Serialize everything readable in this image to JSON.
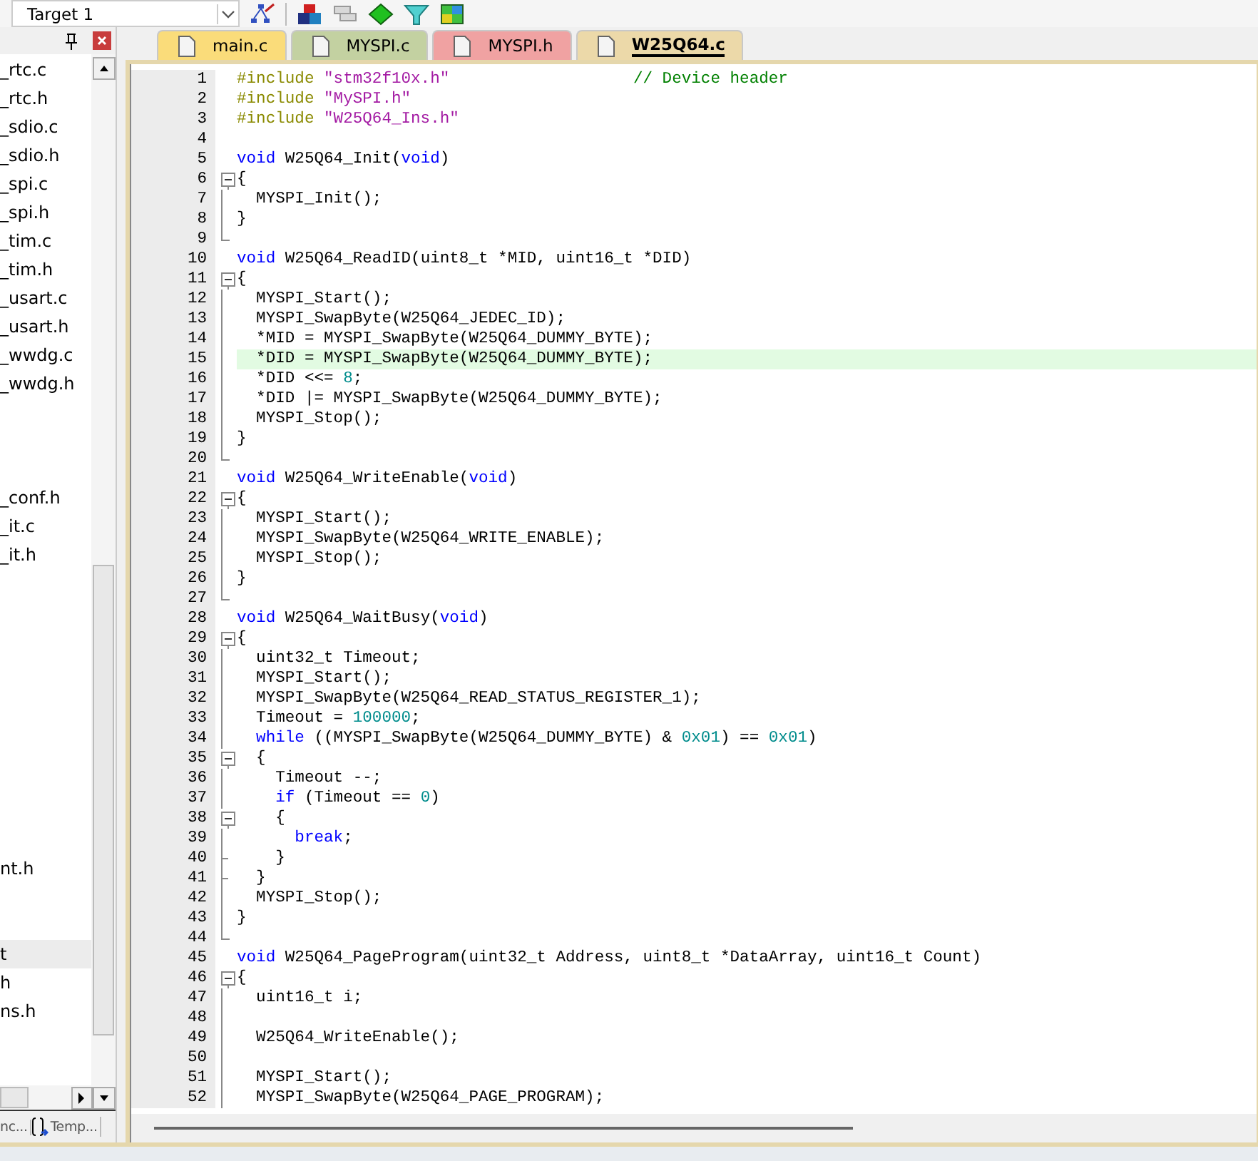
{
  "toolbar": {
    "target": "Target 1"
  },
  "project_panel": {
    "file_groups": [
      [
        {
          "name": "_rtc.c",
          "selected": false
        },
        {
          "name": "_rtc.h",
          "selected": false
        },
        {
          "name": "_sdio.c",
          "selected": false
        },
        {
          "name": "_sdio.h",
          "selected": false
        },
        {
          "name": "_spi.c",
          "selected": false
        },
        {
          "name": "_spi.h",
          "selected": false
        },
        {
          "name": "_tim.c",
          "selected": false
        },
        {
          "name": "_tim.h",
          "selected": false
        },
        {
          "name": "_usart.c",
          "selected": false
        },
        {
          "name": "_usart.h",
          "selected": false
        },
        {
          "name": "_wwdg.c",
          "selected": false
        },
        {
          "name": "_wwdg.h",
          "selected": false
        }
      ],
      [
        {
          "name": "_conf.h",
          "selected": false
        },
        {
          "name": "_it.c",
          "selected": false
        },
        {
          "name": "_it.h",
          "selected": false
        }
      ],
      [
        {
          "name": "nt.h",
          "selected": false
        }
      ],
      [
        {
          "name": "t",
          "selected": true
        },
        {
          "name": "h",
          "selected": false
        },
        {
          "name": "ns.h",
          "selected": false
        }
      ]
    ],
    "bottom_tabs": [
      {
        "label": "nc...",
        "kind": "books"
      },
      {
        "label": "Temp...",
        "kind": "templates"
      }
    ]
  },
  "editor_tabs": [
    {
      "label": "main.c",
      "color": "#fadc7a",
      "selected": false
    },
    {
      "label": "MYSPI.c",
      "color": "#c3d1a1",
      "selected": false
    },
    {
      "label": "MYSPI.h",
      "color": "#f0a2a2",
      "selected": false
    },
    {
      "label": "W25Q64.c",
      "color": "#ecd9a9",
      "selected": true
    }
  ],
  "code": [
    {
      "n": "1",
      "highlight": false,
      "tokens": [
        {
          "kind": "directive",
          "text": "#include"
        },
        {
          "kind": "string",
          "text": " \"stm32f10x.h\""
        },
        {
          "kind": "comment",
          "text": "                   // Device header"
        }
      ]
    },
    {
      "n": "2",
      "highlight": false,
      "tokens": [
        {
          "kind": "directive",
          "text": "#include"
        },
        {
          "kind": "string",
          "text": " \"MySPI.h\""
        }
      ]
    },
    {
      "n": "3",
      "highlight": false,
      "tokens": [
        {
          "kind": "directive",
          "text": "#include"
        },
        {
          "kind": "string",
          "text": " \"W25Q64_Ins.h\""
        }
      ]
    },
    {
      "n": "4",
      "highlight": false
    },
    {
      "n": "5",
      "highlight": false,
      "tokens": [
        {
          "kind": "keyword",
          "text": "void"
        },
        {
          "kind": "plain",
          "text": " W25Q64_Init("
        },
        {
          "kind": "keyword",
          "text": "void"
        },
        {
          "kind": "plain",
          "text": ")"
        }
      ]
    },
    {
      "n": "6",
      "kind": "fold_start",
      "highlight": false,
      "tokens": [
        {
          "kind": "plain",
          "text": "{"
        }
      ]
    },
    {
      "n": "7",
      "kind": "fold_body",
      "highlight": false,
      "tokens": [
        {
          "kind": "plain",
          "text": "  MYSPI_Init();"
        }
      ]
    },
    {
      "n": "8",
      "kind": "fold_body",
      "highlight": false,
      "tokens": [
        {
          "kind": "plain",
          "text": "}"
        }
      ]
    },
    {
      "n": "9",
      "kind": "fold_end",
      "highlight": false
    },
    {
      "n": "10",
      "highlight": false,
      "tokens": [
        {
          "kind": "keyword",
          "text": "void"
        },
        {
          "kind": "plain",
          "text": " W25Q64_ReadID(uint8_t *MID, uint16_t *DID)"
        }
      ]
    },
    {
      "n": "11",
      "kind": "fold_start",
      "highlight": false,
      "tokens": [
        {
          "kind": "plain",
          "text": "{"
        }
      ]
    },
    {
      "n": "12",
      "kind": "fold_body",
      "highlight": false,
      "tokens": [
        {
          "kind": "plain",
          "text": "  MYSPI_Start();"
        }
      ]
    },
    {
      "n": "13",
      "kind": "fold_body",
      "highlight": false,
      "tokens": [
        {
          "kind": "plain",
          "text": "  MYSPI_SwapByte(W25Q64_JEDEC_ID);"
        }
      ]
    },
    {
      "n": "14",
      "kind": "fold_body",
      "highlight": false,
      "tokens": [
        {
          "kind": "plain",
          "text": "  *MID = MYSPI_SwapByte(W25Q64_DUMMY_BYTE);"
        }
      ]
    },
    {
      "n": "15",
      "kind": "fold_body",
      "highlight": true,
      "tokens": [
        {
          "kind": "plain",
          "text": "  *DID = MYSPI_SwapByte(W25Q64_DUMMY_BYTE);"
        }
      ]
    },
    {
      "n": "16",
      "kind": "fold_body",
      "highlight": false,
      "tokens": [
        {
          "kind": "plain",
          "text": "  *DID <<= "
        },
        {
          "kind": "number",
          "text": "8"
        },
        {
          "kind": "plain",
          "text": ";"
        }
      ]
    },
    {
      "n": "17",
      "kind": "fold_body",
      "highlight": false,
      "tokens": [
        {
          "kind": "plain",
          "text": "  *DID |= MYSPI_SwapByte(W25Q64_DUMMY_BYTE);"
        }
      ]
    },
    {
      "n": "18",
      "kind": "fold_body",
      "highlight": false,
      "tokens": [
        {
          "kind": "plain",
          "text": "  MYSPI_Stop();"
        }
      ]
    },
    {
      "n": "19",
      "kind": "fold_body",
      "highlight": false,
      "tokens": [
        {
          "kind": "plain",
          "text": "}"
        }
      ]
    },
    {
      "n": "20",
      "kind": "fold_end",
      "highlight": false
    },
    {
      "n": "21",
      "highlight": false,
      "tokens": [
        {
          "kind": "keyword",
          "text": "void"
        },
        {
          "kind": "plain",
          "text": " W25Q64_WriteEnable("
        },
        {
          "kind": "keyword",
          "text": "void"
        },
        {
          "kind": "plain",
          "text": ")"
        }
      ]
    },
    {
      "n": "22",
      "kind": "fold_start",
      "highlight": false,
      "tokens": [
        {
          "kind": "plain",
          "text": "{"
        }
      ]
    },
    {
      "n": "23",
      "kind": "fold_body",
      "highlight": false,
      "tokens": [
        {
          "kind": "plain",
          "text": "  MYSPI_Start();"
        }
      ]
    },
    {
      "n": "24",
      "kind": "fold_body",
      "highlight": false,
      "tokens": [
        {
          "kind": "plain",
          "text": "  MYSPI_SwapByte(W25Q64_WRITE_ENABLE);"
        }
      ]
    },
    {
      "n": "25",
      "kind": "fold_body",
      "highlight": false,
      "tokens": [
        {
          "kind": "plain",
          "text": "  MYSPI_Stop();"
        }
      ]
    },
    {
      "n": "26",
      "kind": "fold_body",
      "highlight": false,
      "tokens": [
        {
          "kind": "plain",
          "text": "}"
        }
      ]
    },
    {
      "n": "27",
      "kind": "fold_end",
      "highlight": false
    },
    {
      "n": "28",
      "highlight": false,
      "tokens": [
        {
          "kind": "keyword",
          "text": "void"
        },
        {
          "kind": "plain",
          "text": " W25Q64_WaitBusy("
        },
        {
          "kind": "keyword",
          "text": "void"
        },
        {
          "kind": "plain",
          "text": ")"
        }
      ]
    },
    {
      "n": "29",
      "kind": "fold_start",
      "highlight": false,
      "tokens": [
        {
          "kind": "plain",
          "text": "{"
        }
      ]
    },
    {
      "n": "30",
      "kind": "fold_body",
      "highlight": false,
      "tokens": [
        {
          "kind": "plain",
          "text": "  uint32_t Timeout;"
        }
      ]
    },
    {
      "n": "31",
      "kind": "fold_body",
      "highlight": false,
      "tokens": [
        {
          "kind": "plain",
          "text": "  MYSPI_Start();"
        }
      ]
    },
    {
      "n": "32",
      "kind": "fold_body",
      "highlight": false,
      "tokens": [
        {
          "kind": "plain",
          "text": "  MYSPI_SwapByte(W25Q64_READ_STATUS_REGISTER_1);"
        }
      ]
    },
    {
      "n": "33",
      "kind": "fold_body",
      "highlight": false,
      "tokens": [
        {
          "kind": "plain",
          "text": "  Timeout = "
        },
        {
          "kind": "number",
          "text": "100000"
        },
        {
          "kind": "plain",
          "text": ";"
        }
      ]
    },
    {
      "n": "34",
      "kind": "fold_body",
      "highlight": false,
      "tokens": [
        {
          "kind": "keyword",
          "text": "  while"
        },
        {
          "kind": "plain",
          "text": " ((MYSPI_SwapByte(W25Q64_DUMMY_BYTE) & "
        },
        {
          "kind": "number",
          "text": "0x01"
        },
        {
          "kind": "plain",
          "text": ") == "
        },
        {
          "kind": "number",
          "text": "0x01"
        },
        {
          "kind": "plain",
          "text": ")"
        }
      ]
    },
    {
      "n": "35",
      "kind": "fold_start",
      "highlight": false,
      "tokens": [
        {
          "kind": "plain",
          "text": "  {"
        }
      ]
    },
    {
      "n": "36",
      "kind": "fold_body",
      "highlight": false,
      "tokens": [
        {
          "kind": "plain",
          "text": "    Timeout --;"
        }
      ]
    },
    {
      "n": "37",
      "kind": "fold_body",
      "highlight": false,
      "tokens": [
        {
          "kind": "keyword",
          "text": "    if"
        },
        {
          "kind": "plain",
          "text": " (Timeout == "
        },
        {
          "kind": "number",
          "text": "0"
        },
        {
          "kind": "plain",
          "text": ")"
        }
      ]
    },
    {
      "n": "38",
      "kind": "fold_start",
      "highlight": false,
      "tokens": [
        {
          "kind": "plain",
          "text": "    {"
        }
      ]
    },
    {
      "n": "39",
      "kind": "fold_body",
      "highlight": false,
      "tokens": [
        {
          "kind": "keyword",
          "text": "      break"
        },
        {
          "kind": "plain",
          "text": ";"
        }
      ]
    },
    {
      "n": "40",
      "kind": "fold_branch",
      "highlight": false,
      "tokens": [
        {
          "kind": "plain",
          "text": "    }"
        }
      ]
    },
    {
      "n": "41",
      "kind": "fold_branch",
      "highlight": false,
      "tokens": [
        {
          "kind": "plain",
          "text": "  }"
        }
      ]
    },
    {
      "n": "42",
      "kind": "fold_body",
      "highlight": false,
      "tokens": [
        {
          "kind": "plain",
          "text": "  MYSPI_Stop();"
        }
      ]
    },
    {
      "n": "43",
      "kind": "fold_body",
      "highlight": false,
      "tokens": [
        {
          "kind": "plain",
          "text": "}"
        }
      ]
    },
    {
      "n": "44",
      "kind": "fold_end",
      "highlight": false
    },
    {
      "n": "45",
      "highlight": false,
      "tokens": [
        {
          "kind": "keyword",
          "text": "void"
        },
        {
          "kind": "plain",
          "text": " W25Q64_PageProgram(uint32_t Address, uint8_t *DataArray, uint16_t Count)"
        }
      ]
    },
    {
      "n": "46",
      "kind": "fold_start",
      "highlight": false,
      "tokens": [
        {
          "kind": "plain",
          "text": "{"
        }
      ]
    },
    {
      "n": "47",
      "kind": "fold_body",
      "highlight": false,
      "tokens": [
        {
          "kind": "plain",
          "text": "  uint16_t i;"
        }
      ]
    },
    {
      "n": "48",
      "kind": "fold_body",
      "highlight": false
    },
    {
      "n": "49",
      "kind": "fold_body",
      "highlight": false,
      "tokens": [
        {
          "kind": "plain",
          "text": "  W25Q64_WriteEnable();"
        }
      ]
    },
    {
      "n": "50",
      "kind": "fold_body",
      "highlight": false
    },
    {
      "n": "51",
      "kind": "fold_body",
      "highlight": false,
      "tokens": [
        {
          "kind": "plain",
          "text": "  MYSPI_Start();"
        }
      ]
    },
    {
      "n": "52",
      "kind": "fold_body",
      "highlight": false,
      "tokens": [
        {
          "kind": "plain",
          "text": "  MYSPI_SwapByte(W25Q64_PAGE_PROGRAM);"
        }
      ]
    }
  ]
}
